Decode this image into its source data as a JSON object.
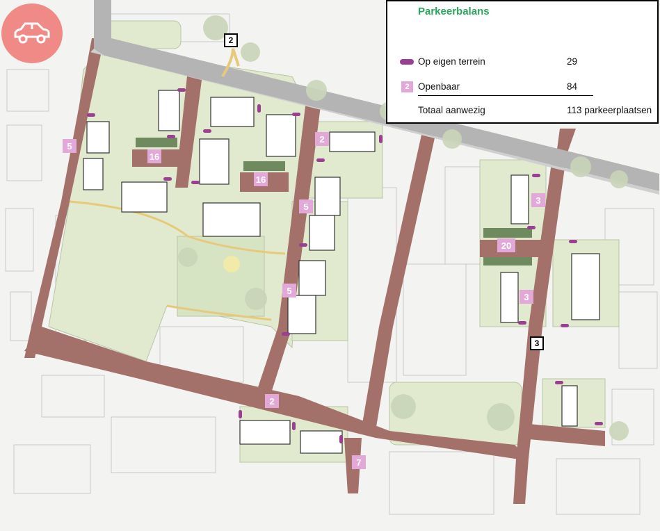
{
  "legend": {
    "title": "Parkeerbalans",
    "own_terrain": {
      "label": "Op eigen terrein",
      "value": "29"
    },
    "public": {
      "label": "Openbaar",
      "value": "84",
      "icon_number": "2"
    },
    "total": {
      "label": "Totaal aanwezig",
      "value": "113 parkeerplaatsen"
    }
  },
  "icon": {
    "name": "car-icon",
    "color": "#ef8a86"
  },
  "colors": {
    "road": "#a4706a",
    "green": "#e1eacf",
    "parking_pill": "#9b3f92",
    "count_badge": "#e2a8d8"
  },
  "public_parking_counts": [
    {
      "id": "west-street",
      "count": "5"
    },
    {
      "id": "courtyard-west",
      "count": "16"
    },
    {
      "id": "courtyard-center",
      "count": "16"
    },
    {
      "id": "street-top-center",
      "count": "2"
    },
    {
      "id": "street-center-upper",
      "count": "5"
    },
    {
      "id": "street-center-lower",
      "count": "5"
    },
    {
      "id": "south-street",
      "count": "2"
    },
    {
      "id": "south-corner",
      "count": "7"
    },
    {
      "id": "east-top",
      "count": "3"
    },
    {
      "id": "east-courtyard",
      "count": "20"
    },
    {
      "id": "east-middle",
      "count": "3"
    }
  ],
  "access_points": [
    {
      "id": "north-access",
      "number": "2"
    },
    {
      "id": "east-access",
      "number": "3"
    }
  ]
}
